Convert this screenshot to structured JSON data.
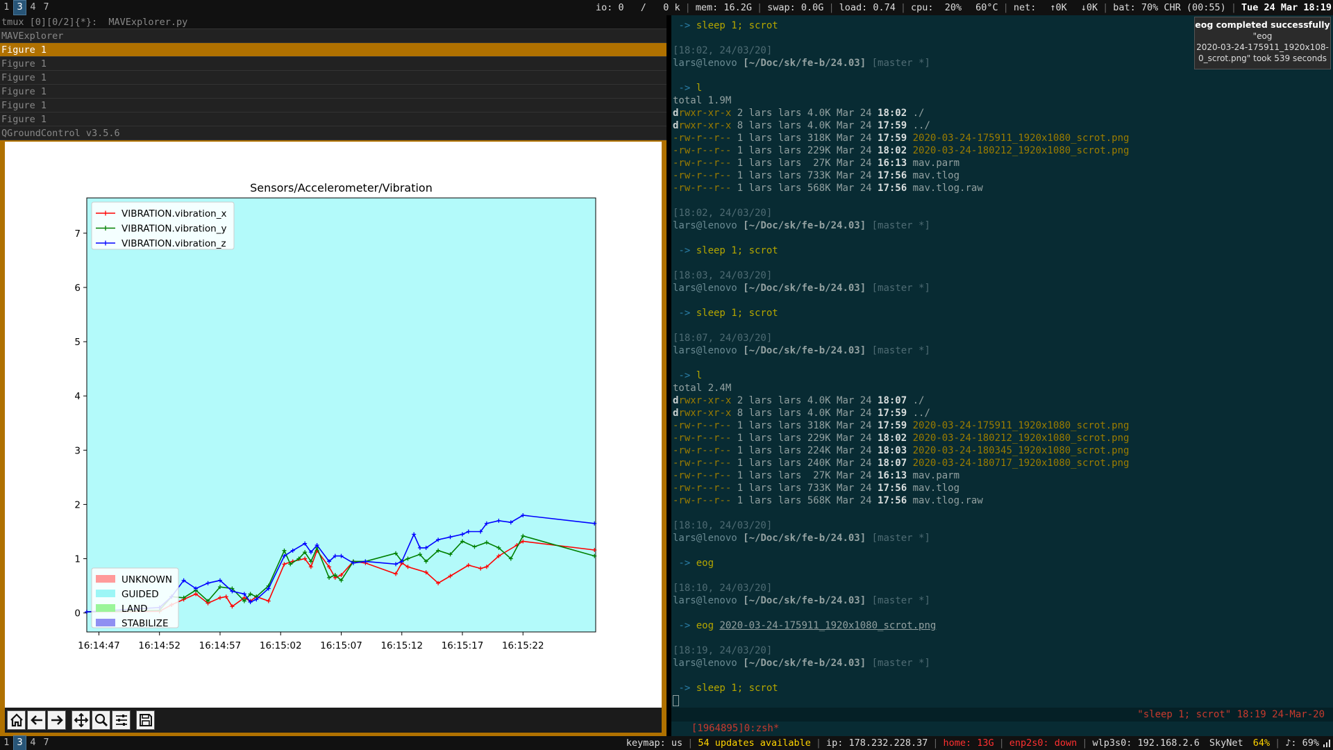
{
  "topbar": {
    "workspaces": [
      {
        "label": "1",
        "active": false
      },
      {
        "label": "3",
        "active": true
      },
      {
        "label": "4",
        "active": false
      },
      {
        "label": "7",
        "active": false
      }
    ],
    "status": {
      "io": "io: 0",
      "io_rate": "/   0 k",
      "mem": "mem: 16.2G",
      "swap": "swap: 0.0G",
      "load": "load: 0.74",
      "cpu": "cpu:  20%",
      "temp": "60°C",
      "net": "net:",
      "net_up": "↑0K",
      "net_down": "↓0K",
      "bat": "bat: 70% CHR (00:55)",
      "clock": "Tue 24 Mar 18:19"
    }
  },
  "left_tabs": [
    {
      "label": "tmux [0][0/2]{*}:  MAVExplorer.py",
      "state": "inactive"
    },
    {
      "label": "MAVExplorer",
      "state": "normal"
    },
    {
      "label": "Figure 1",
      "state": "focused"
    },
    {
      "label": "Figure 1",
      "state": "normal"
    },
    {
      "label": "Figure 1",
      "state": "normal"
    },
    {
      "label": "Figure 1",
      "state": "normal"
    },
    {
      "label": "Figure 1",
      "state": "normal"
    },
    {
      "label": "Figure 1",
      "state": "normal"
    },
    {
      "label": "QGroundControl v3.5.6",
      "state": "normal"
    }
  ],
  "chart_data": {
    "type": "line",
    "title": "Sensors/Accelerometer/Vibration",
    "xlabel": "",
    "ylabel": "",
    "x_ticks": [
      "16:14:47",
      "16:14:52",
      "16:14:57",
      "16:15:02",
      "16:15:07",
      "16:15:12",
      "16:15:17",
      "16:15:22"
    ],
    "x_tick_seconds": [
      0,
      5,
      10,
      15,
      20,
      25,
      30,
      35
    ],
    "xlim": [
      -1,
      41
    ],
    "yticks": [
      0,
      1,
      2,
      3,
      4,
      5,
      6,
      7
    ],
    "ylim": [
      -0.35,
      7.65
    ],
    "grid": false,
    "background_color": "#b3fafa",
    "legend_series_placement": "top-left",
    "legend_modes_placement": "bottom-left",
    "series": [
      {
        "name": "VIBRATION.vibration_x",
        "color": "#ff0000",
        "x": [
          -1,
          5,
          6,
          7,
          8,
          9,
          10,
          10.5,
          11,
          12,
          12.5,
          13,
          14,
          15.3,
          16,
          17,
          17.5,
          18,
          19,
          19.5,
          20,
          21,
          22,
          24.5,
          25,
          25.5,
          27,
          28,
          29,
          30.5,
          31.5,
          32,
          33,
          34.5,
          35,
          40.9
        ],
        "y": [
          0.02,
          0.03,
          0.15,
          0.25,
          0.35,
          0.18,
          0.28,
          0.3,
          0.12,
          0.28,
          0.22,
          0.3,
          0.22,
          0.9,
          0.95,
          1.0,
          0.85,
          1.15,
          0.85,
          0.65,
          0.7,
          0.95,
          0.92,
          0.72,
          0.92,
          0.85,
          0.75,
          0.55,
          0.68,
          0.88,
          0.82,
          0.85,
          1.05,
          1.25,
          1.32,
          1.16
        ]
      },
      {
        "name": "VIBRATION.vibration_y",
        "color": "#008000",
        "x": [
          -1,
          5,
          6,
          7,
          8,
          9,
          10,
          11,
          12,
          12.5,
          13,
          14,
          15.3,
          15.8,
          16.5,
          17,
          17.5,
          18,
          19,
          19.5,
          20,
          21,
          22,
          24.5,
          25,
          25.5,
          26.5,
          27,
          28,
          29,
          30,
          31,
          32,
          33,
          34,
          35,
          40.9
        ],
        "y": [
          0.02,
          0.05,
          0.3,
          0.28,
          0.42,
          0.22,
          0.48,
          0.45,
          0.22,
          0.35,
          0.3,
          0.5,
          1.15,
          0.9,
          1.0,
          1.12,
          0.95,
          1.2,
          0.65,
          0.7,
          0.6,
          0.95,
          0.95,
          1.1,
          0.95,
          1.0,
          1.08,
          0.95,
          1.15,
          1.08,
          1.32,
          1.22,
          1.3,
          1.2,
          1.0,
          1.42,
          1.05
        ]
      },
      {
        "name": "VIBRATION.vibration_z",
        "color": "#0000ff",
        "x": [
          -1,
          5,
          6,
          7,
          8,
          9,
          10,
          11,
          12,
          12.5,
          13,
          14,
          15.3,
          16,
          17,
          17.5,
          18,
          19,
          19.5,
          20,
          21,
          22,
          24.5,
          25,
          26,
          26.5,
          27,
          28,
          29,
          30,
          30.5,
          31.5,
          32,
          33,
          34,
          35,
          40.9
        ],
        "y": [
          0.02,
          0.1,
          0.3,
          0.6,
          0.45,
          0.55,
          0.6,
          0.4,
          0.35,
          0.2,
          0.25,
          0.45,
          1.05,
          1.15,
          1.28,
          1.12,
          1.25,
          0.95,
          1.05,
          1.05,
          0.92,
          0.95,
          0.9,
          0.95,
          1.45,
          1.2,
          1.2,
          1.35,
          1.4,
          1.45,
          1.5,
          1.5,
          1.65,
          1.7,
          1.67,
          1.8,
          1.65
        ]
      }
    ],
    "mode_legend": [
      {
        "name": "UNKNOWN",
        "color": "#ff9a9a"
      },
      {
        "name": "GUIDED",
        "color": "#9cf6f6"
      },
      {
        "name": "LAND",
        "color": "#9af59a"
      },
      {
        "name": "STABILIZE",
        "color": "#8f8ff2"
      }
    ]
  },
  "toolbar": {
    "buttons": [
      {
        "name": "home-button",
        "icon": "home-icon"
      },
      {
        "name": "back-button",
        "icon": "arrow-left-icon"
      },
      {
        "name": "forward-button",
        "icon": "arrow-right-icon"
      },
      {
        "name": "pan-button",
        "icon": "move-icon"
      },
      {
        "name": "zoom-button",
        "icon": "magnifier-icon"
      },
      {
        "name": "configure-button",
        "icon": "sliders-icon"
      },
      {
        "name": "save-button",
        "icon": "floppy-icon"
      }
    ]
  },
  "terminal": {
    "lines": [
      [
        {
          "c": "t-prompt",
          "t": " -> "
        },
        {
          "c": "t-cmd",
          "t": "sleep 1; scrot"
        }
      ],
      [],
      [
        {
          "c": "t-dim",
          "t": "[18:02, 24/03/20]"
        }
      ],
      [
        {
          "c": "t-user",
          "t": "lars@lenovo "
        },
        {
          "c": "t-path",
          "t": "[~/Doc/sk/fe-b/24.03]"
        },
        {
          "c": "t-dim",
          "t": " [master *]"
        }
      ],
      [],
      [
        {
          "c": "t-prompt",
          "t": " -> "
        },
        {
          "c": "t-cmd",
          "t": "l"
        }
      ],
      [
        {
          "c": "",
          "t": "total 1.9M"
        }
      ],
      [
        {
          "c": "t-perm-d",
          "t": "d"
        },
        {
          "c": "t-perm",
          "t": "rwxr-xr-x"
        },
        {
          "c": "",
          "t": " 2 lars lars 4.0K Mar 24 "
        },
        {
          "c": "t-time",
          "t": "18:02"
        },
        {
          "c": "",
          "t": " ./"
        }
      ],
      [
        {
          "c": "t-perm-d",
          "t": "d"
        },
        {
          "c": "t-perm",
          "t": "rwxr-xr-x"
        },
        {
          "c": "",
          "t": " 8 lars lars 4.0K Mar 24 "
        },
        {
          "c": "t-time",
          "t": "17:59"
        },
        {
          "c": "",
          "t": " ../"
        }
      ],
      [
        {
          "c": "t-perm",
          "t": "-rw-r--r--"
        },
        {
          "c": "",
          "t": " 1 lars lars 318K Mar 24 "
        },
        {
          "c": "t-time",
          "t": "17:59"
        },
        {
          "c": "t-file",
          "t": " 2020-03-24-175911_1920x1080_scrot.png"
        }
      ],
      [
        {
          "c": "t-perm",
          "t": "-rw-r--r--"
        },
        {
          "c": "",
          "t": " 1 lars lars 229K Mar 24 "
        },
        {
          "c": "t-time",
          "t": "18:02"
        },
        {
          "c": "t-file",
          "t": " 2020-03-24-180212_1920x1080_scrot.png"
        }
      ],
      [
        {
          "c": "t-perm",
          "t": "-rw-r--r--"
        },
        {
          "c": "",
          "t": " 1 lars lars  27K Mar 24 "
        },
        {
          "c": "t-time",
          "t": "16:13"
        },
        {
          "c": "",
          "t": " mav.parm"
        }
      ],
      [
        {
          "c": "t-perm",
          "t": "-rw-r--r--"
        },
        {
          "c": "",
          "t": " 1 lars lars 733K Mar 24 "
        },
        {
          "c": "t-time",
          "t": "17:56"
        },
        {
          "c": "",
          "t": " mav.tlog"
        }
      ],
      [
        {
          "c": "t-perm",
          "t": "-rw-r--r--"
        },
        {
          "c": "",
          "t": " 1 lars lars 568K Mar 24 "
        },
        {
          "c": "t-time",
          "t": "17:56"
        },
        {
          "c": "",
          "t": " mav.tlog.raw"
        }
      ],
      [],
      [
        {
          "c": "t-dim",
          "t": "[18:02, 24/03/20]"
        }
      ],
      [
        {
          "c": "t-user",
          "t": "lars@lenovo "
        },
        {
          "c": "t-path",
          "t": "[~/Doc/sk/fe-b/24.03]"
        },
        {
          "c": "t-dim",
          "t": " [master *]"
        }
      ],
      [],
      [
        {
          "c": "t-prompt",
          "t": " -> "
        },
        {
          "c": "t-cmd",
          "t": "sleep 1; scrot"
        }
      ],
      [],
      [
        {
          "c": "t-dim",
          "t": "[18:03, 24/03/20]"
        }
      ],
      [
        {
          "c": "t-user",
          "t": "lars@lenovo "
        },
        {
          "c": "t-path",
          "t": "[~/Doc/sk/fe-b/24.03]"
        },
        {
          "c": "t-dim",
          "t": " [master *]"
        }
      ],
      [],
      [
        {
          "c": "t-prompt",
          "t": " -> "
        },
        {
          "c": "t-cmd",
          "t": "sleep 1; scrot"
        }
      ],
      [],
      [
        {
          "c": "t-dim",
          "t": "[18:07, 24/03/20]"
        }
      ],
      [
        {
          "c": "t-user",
          "t": "lars@lenovo "
        },
        {
          "c": "t-path",
          "t": "[~/Doc/sk/fe-b/24.03]"
        },
        {
          "c": "t-dim",
          "t": " [master *]"
        }
      ],
      [],
      [
        {
          "c": "t-prompt",
          "t": " -> "
        },
        {
          "c": "t-cmd",
          "t": "l"
        }
      ],
      [
        {
          "c": "",
          "t": "total 2.4M"
        }
      ],
      [
        {
          "c": "t-perm-d",
          "t": "d"
        },
        {
          "c": "t-perm",
          "t": "rwxr-xr-x"
        },
        {
          "c": "",
          "t": " 2 lars lars 4.0K Mar 24 "
        },
        {
          "c": "t-time",
          "t": "18:07"
        },
        {
          "c": "",
          "t": " ./"
        }
      ],
      [
        {
          "c": "t-perm-d",
          "t": "d"
        },
        {
          "c": "t-perm",
          "t": "rwxr-xr-x"
        },
        {
          "c": "",
          "t": " 8 lars lars 4.0K Mar 24 "
        },
        {
          "c": "t-time",
          "t": "17:59"
        },
        {
          "c": "",
          "t": " ../"
        }
      ],
      [
        {
          "c": "t-perm",
          "t": "-rw-r--r--"
        },
        {
          "c": "",
          "t": " 1 lars lars 318K Mar 24 "
        },
        {
          "c": "t-time",
          "t": "17:59"
        },
        {
          "c": "t-file",
          "t": " 2020-03-24-175911_1920x1080_scrot.png"
        }
      ],
      [
        {
          "c": "t-perm",
          "t": "-rw-r--r--"
        },
        {
          "c": "",
          "t": " 1 lars lars 229K Mar 24 "
        },
        {
          "c": "t-time",
          "t": "18:02"
        },
        {
          "c": "t-file",
          "t": " 2020-03-24-180212_1920x1080_scrot.png"
        }
      ],
      [
        {
          "c": "t-perm",
          "t": "-rw-r--r--"
        },
        {
          "c": "",
          "t": " 1 lars lars 224K Mar 24 "
        },
        {
          "c": "t-time",
          "t": "18:03"
        },
        {
          "c": "t-file",
          "t": " 2020-03-24-180345_1920x1080_scrot.png"
        }
      ],
      [
        {
          "c": "t-perm",
          "t": "-rw-r--r--"
        },
        {
          "c": "",
          "t": " 1 lars lars 240K Mar 24 "
        },
        {
          "c": "t-time",
          "t": "18:07"
        },
        {
          "c": "t-file",
          "t": " 2020-03-24-180717_1920x1080_scrot.png"
        }
      ],
      [
        {
          "c": "t-perm",
          "t": "-rw-r--r--"
        },
        {
          "c": "",
          "t": " 1 lars lars  27K Mar 24 "
        },
        {
          "c": "t-time",
          "t": "16:13"
        },
        {
          "c": "",
          "t": " mav.parm"
        }
      ],
      [
        {
          "c": "t-perm",
          "t": "-rw-r--r--"
        },
        {
          "c": "",
          "t": " 1 lars lars 733K Mar 24 "
        },
        {
          "c": "t-time",
          "t": "17:56"
        },
        {
          "c": "",
          "t": " mav.tlog"
        }
      ],
      [
        {
          "c": "t-perm",
          "t": "-rw-r--r--"
        },
        {
          "c": "",
          "t": " 1 lars lars 568K Mar 24 "
        },
        {
          "c": "t-time",
          "t": "17:56"
        },
        {
          "c": "",
          "t": " mav.tlog.raw"
        }
      ],
      [],
      [
        {
          "c": "t-dim",
          "t": "[18:10, 24/03/20]"
        }
      ],
      [
        {
          "c": "t-user",
          "t": "lars@lenovo "
        },
        {
          "c": "t-path",
          "t": "[~/Doc/sk/fe-b/24.03]"
        },
        {
          "c": "t-dim",
          "t": " [master *]"
        }
      ],
      [],
      [
        {
          "c": "t-prompt",
          "t": " -> "
        },
        {
          "c": "t-cmd",
          "t": "eog"
        }
      ],
      [],
      [
        {
          "c": "t-dim",
          "t": "[18:10, 24/03/20]"
        }
      ],
      [
        {
          "c": "t-user",
          "t": "lars@lenovo "
        },
        {
          "c": "t-path",
          "t": "[~/Doc/sk/fe-b/24.03]"
        },
        {
          "c": "t-dim",
          "t": " [master *]"
        }
      ],
      [],
      [
        {
          "c": "t-prompt",
          "t": " -> "
        },
        {
          "c": "t-cmd",
          "t": "eog "
        },
        {
          "c": "t-under",
          "t": "2020-03-24-175911_1920x1080_scrot.png"
        }
      ],
      [],
      [
        {
          "c": "t-dim",
          "t": "[18:19, 24/03/20]"
        }
      ],
      [
        {
          "c": "t-user",
          "t": "lars@lenovo "
        },
        {
          "c": "t-path",
          "t": "[~/Doc/sk/fe-b/24.03]"
        },
        {
          "c": "t-dim",
          "t": " [master *]"
        }
      ],
      [],
      [
        {
          "c": "t-prompt",
          "t": " -> "
        },
        {
          "c": "t-cmd",
          "t": "sleep 1; scrot"
        }
      ]
    ],
    "tmux_left": "[1964895]0:zsh*",
    "tmux_right": "\"sleep 1; scrot\" 18:19 24-Mar-20"
  },
  "notification": {
    "title": "eog completed successfully",
    "line1": "\"eog",
    "line2": "2020-03-24-175911_1920x108-",
    "line3": "0_scrot.png\" took 539 seconds"
  },
  "bottombar": {
    "workspaces": [
      {
        "label": "1",
        "active": false
      },
      {
        "label": "3",
        "active": true
      },
      {
        "label": "4",
        "active": false
      },
      {
        "label": "7",
        "active": false
      }
    ],
    "keymap": "keymap: us",
    "updates": "54 updates available",
    "ip": "ip: 178.232.228.37",
    "home": "home: 13G",
    "eth": "enp2s0: down",
    "wifi": "wlp3s0: 192.168.2.6",
    "ssid": "SkyNet",
    "wifi_quality": "64%",
    "volume": "♪: 69%"
  }
}
